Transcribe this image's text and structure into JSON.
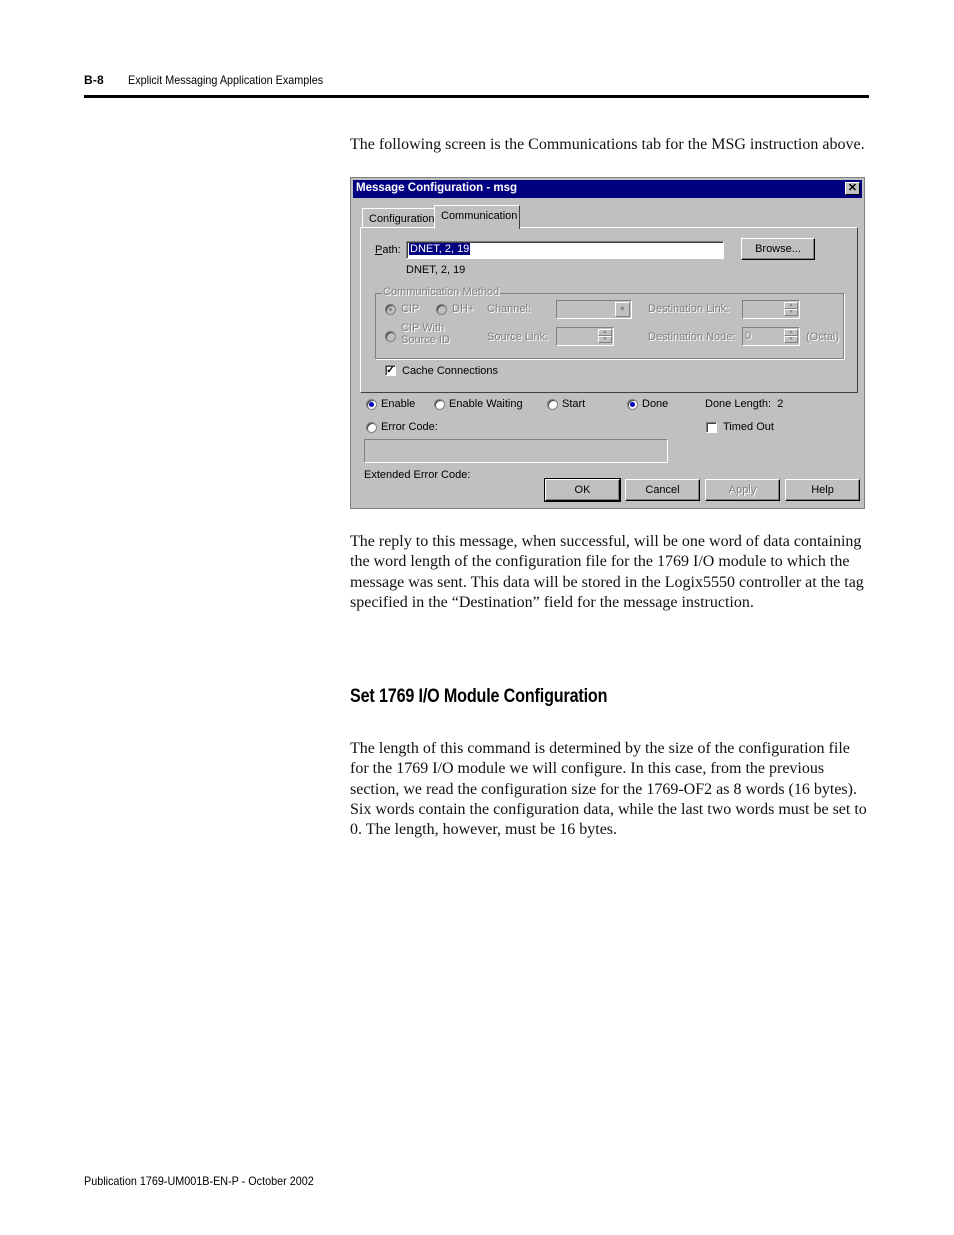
{
  "header": {
    "page_number": "B-8",
    "chapter_title": "Explicit Messaging Application Examples"
  },
  "intro_paragraph": "The following screen is the Communications tab for the MSG instruction above.",
  "dialog": {
    "title": "Message Configuration - msg",
    "close_icon": "close-icon",
    "tabs": [
      {
        "label": "Configuration",
        "active": false
      },
      {
        "label": "Communication",
        "active": true
      }
    ],
    "path_label": "Path:",
    "path_value": "DNET, 2, 19",
    "path_resolved": "DNET, 2, 19",
    "browse_label": "Browse...",
    "comm_method": {
      "legend": "Communication Method",
      "radio_cip": "CIP",
      "radio_dhplus": "DH+",
      "channel_label": "Channel:",
      "channel_value": "",
      "radio_cip_source_line1": "CIP With",
      "radio_cip_source_line2": "Source ID",
      "source_link_label": "Source Link:",
      "source_link_value": "",
      "dest_link_label": "Destination Link:",
      "dest_link_value": "",
      "dest_node_label": "Destination Node:",
      "dest_node_value": "0",
      "octal_label": "(Octal)"
    },
    "cache_connections_label": "Cache Connections",
    "cache_connections_checked": true,
    "status": {
      "enable": "Enable",
      "enable_waiting": "Enable Waiting",
      "start": "Start",
      "done": "Done",
      "done_length_label": "Done Length:",
      "done_length_value": "2",
      "error_code": "Error Code:",
      "timed_out": "Timed Out",
      "timed_out_checked": false,
      "extended_error_code": "Extended Error Code:",
      "error_code_value": ""
    },
    "buttons": {
      "ok": "OK",
      "cancel": "Cancel",
      "apply": "Apply",
      "help": "Help"
    },
    "colors": {
      "titlebar": "#000080",
      "face": "#c0c0c0",
      "selection": "#000080"
    }
  },
  "reply_paragraph": "The reply to this message, when successful, will be one word of data containing the word length of the configuration file for the 1769 I/O module to which the message was sent. This data will be stored in the Logix5550 controller at the tag specified in the “Destination” field for the message instruction.",
  "section": {
    "heading": "Set 1769 I/O Module Configuration",
    "body": "The length of this command is determined by the size of the configuration file for the 1769 I/O module we will configure. In this case, from the previous section, we read the configuration size for the 1769-OF2 as 8 words (16 bytes). Six words contain the configuration data, while the last two words must be set to 0. The length, however, must be 16 bytes."
  },
  "footer": {
    "publication": "Publication 1769-UM001B-EN-P - October 2002"
  }
}
